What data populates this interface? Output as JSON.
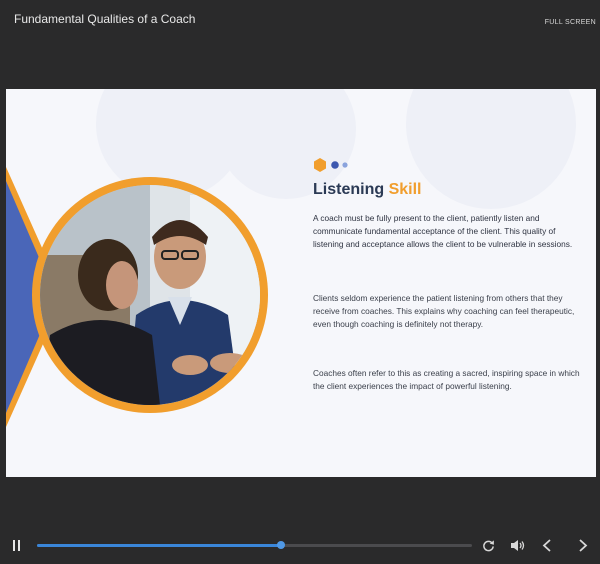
{
  "window": {
    "title": "Fundamental Qualities of a Coach",
    "fullscreen_label": "FULL SCREEN"
  },
  "slide": {
    "heading": {
      "main": "Listening",
      "accent": "Skill"
    },
    "paragraphs": [
      "A coach must be fully present to the client, patiently listen and communicate fundamental acceptance of the client. This quality of listening and acceptance allows the client to be vulnerable in sessions.",
      "Clients seldom experience the patient listening from others that they receive from coaches. This explains why coaching can feel therapeutic, even though coaching is definitely not therapy.",
      "Coaches often refer to this as creating a sacred, inspiring space in which the client experiences the impact of powerful listening."
    ],
    "image": {
      "description": "two-men-talking-photo"
    },
    "colors": {
      "accent": "#f19e2d",
      "blue": "#4a66b8",
      "heading": "#2b3a55"
    }
  },
  "player": {
    "progress": 0.56,
    "icons": [
      "pause-icon",
      "replay-icon",
      "volume-icon",
      "prev-icon",
      "next-icon"
    ]
  }
}
